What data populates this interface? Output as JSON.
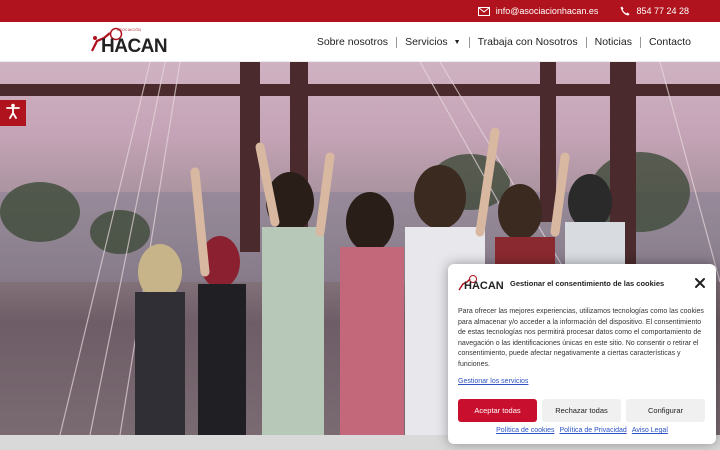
{
  "topbar": {
    "email": "info@asociacionhacan.es",
    "phone": "854 77 24 28",
    "icons": [
      "envelope-icon",
      "phone-icon"
    ]
  },
  "header": {
    "logo_text": "HACAN",
    "logo_subtext": "ASOCIACIÓN",
    "nav": [
      {
        "label": "Sobre nosotros"
      },
      {
        "label": "Servicios"
      },
      {
        "label": "Trabaja con Nosotros"
      },
      {
        "label": "Noticias"
      },
      {
        "label": "Contacto"
      }
    ]
  },
  "accessibility": {
    "icon": "accessibility-icon"
  },
  "cookie": {
    "title": "Gestionar el consentimiento de las cookies",
    "message": "Para ofrecer las mejores experiencias, utilizamos tecnologías como las cookies para almacenar y/o acceder a la información del dispositivo. El consentimiento de estas tecnologías nos permitirá procesar datos como el comportamiento de navegación o las identificaciones únicas en este sitio. No consentir o retirar el consentimiento, puede afectar negativamente a ciertas características y funciones.",
    "manage_services": "Gestionar los servicios",
    "accept": "Aceptar todas",
    "reject": "Rechazar todas",
    "configure": "Configurar",
    "links": [
      "Política de cookies",
      "Política de Privacidad",
      "Aviso Legal"
    ]
  },
  "colors": {
    "brand": "#b0131d",
    "accept": "#c8102e",
    "link": "#2b52c4"
  }
}
